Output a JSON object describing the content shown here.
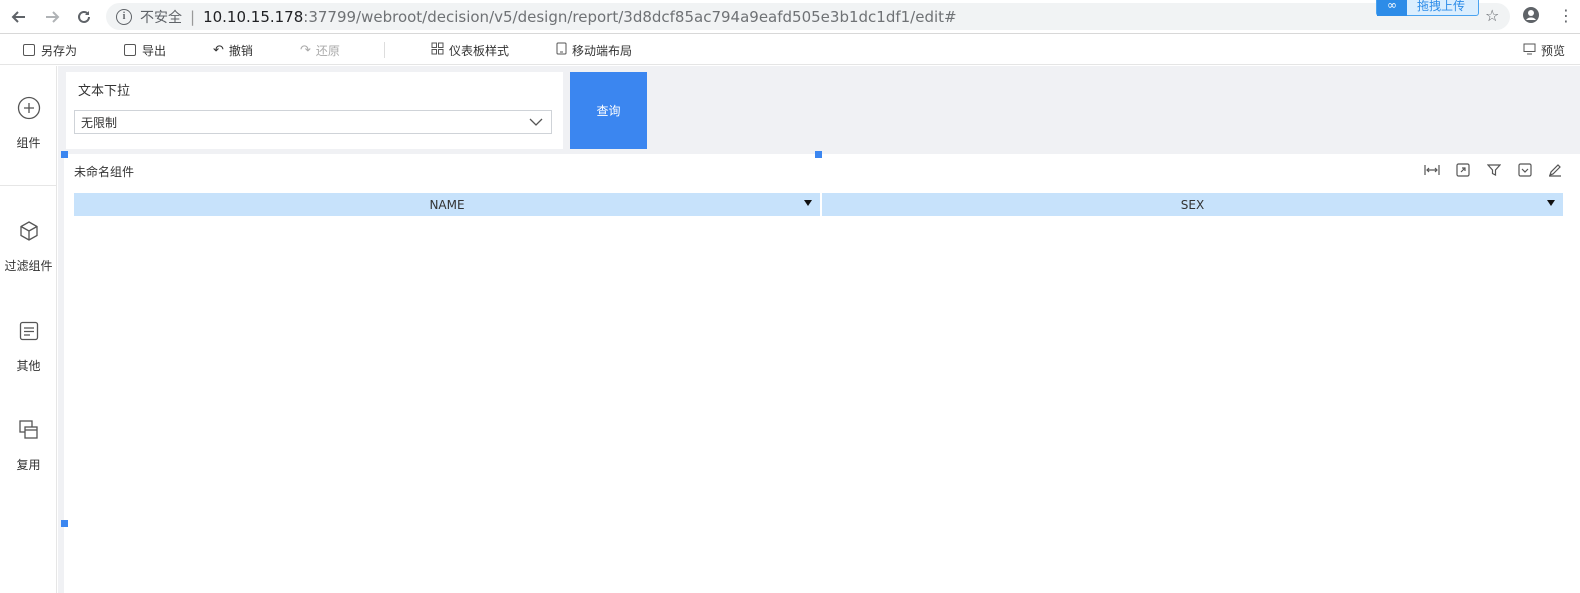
{
  "browser": {
    "security_label": "不安全",
    "url_host": "10.10.15.178",
    "url_path": ":37799/webroot/decision/v5/design/report/3d8dcf85ac794a9eafd505e3b1dc1df1/edit#",
    "upload_badge_label": "拖拽上传"
  },
  "toolbar": {
    "save_as": "另存为",
    "export": "导出",
    "undo": "撤销",
    "redo": "还原",
    "dashboard_style": "仪表板样式",
    "mobile_layout": "移动端布局",
    "preview": "预览"
  },
  "sidebar": {
    "items": [
      {
        "label": "组件",
        "icon": "plus-circle-icon"
      },
      {
        "label": "过滤组件",
        "icon": "cube-icon"
      },
      {
        "label": "其他",
        "icon": "document-icon"
      },
      {
        "label": "复用",
        "icon": "copy-icon"
      }
    ]
  },
  "filter": {
    "title": "文本下拉",
    "select_value": "无限制",
    "query_button": "查询"
  },
  "widget": {
    "title": "未命名组件",
    "columns": [
      "NAME",
      "SEX"
    ]
  },
  "colors": {
    "accent": "#3b86f0",
    "table_header": "#c7e2fb",
    "canvas_bg": "#f0f1f4"
  }
}
